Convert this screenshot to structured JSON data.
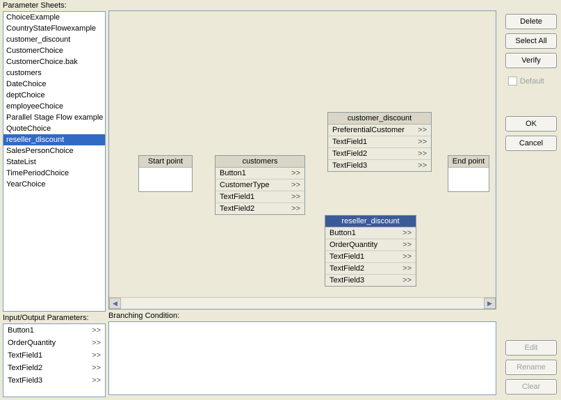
{
  "labels": {
    "parameter_sheets": "Parameter Sheets:",
    "io_params": "Input/Output Parameters:",
    "branching": "Branching Condition:",
    "default": "Default"
  },
  "buttons": {
    "delete": "Delete",
    "select_all": "Select All",
    "verify": "Verify",
    "ok": "OK",
    "cancel": "Cancel",
    "edit": "Edit",
    "rename": "Rename",
    "clear": "Clear"
  },
  "sheets": [
    "ChoiceExample",
    "CountryStateFlowexample",
    "customer_discount",
    "CustomerChoice",
    "CustomerChoice.bak",
    "customers",
    "DateChoice",
    "deptChoice",
    "employeeChoice",
    "Parallel Stage Flow example",
    "QuoteChoice",
    "reseller_discount",
    "SalesPersonChoice",
    "StateList",
    "TimePeriodChoice",
    "YearChoice"
  ],
  "selected_sheet_index": 11,
  "io_params": [
    "Button1",
    "OrderQuantity",
    "TextField1",
    "TextField2",
    "TextField3"
  ],
  "canvas_nodes": {
    "start": {
      "title": "Start point"
    },
    "end": {
      "title": "End point"
    },
    "customers": {
      "title": "customers",
      "rows": [
        "Button1",
        "CustomerType",
        "TextField1",
        "TextField2"
      ]
    },
    "customer_discount": {
      "title": "customer_discount",
      "rows": [
        "PreferentialCustomer",
        "TextField1",
        "TextField2",
        "TextField3"
      ]
    },
    "reseller_discount": {
      "title": "reseller_discount",
      "rows": [
        "Button1",
        "OrderQuantity",
        "TextField1",
        "TextField2",
        "TextField3"
      ]
    }
  },
  "chevron": ">>"
}
